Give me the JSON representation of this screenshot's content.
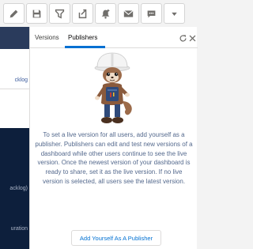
{
  "toolbar": {
    "buttons": [
      {
        "icon": "pencil-icon"
      },
      {
        "icon": "save-icon"
      },
      {
        "icon": "filter-funnel-icon"
      },
      {
        "icon": "share-icon"
      },
      {
        "icon": "notification-bell-icon"
      },
      {
        "icon": "email-icon"
      },
      {
        "icon": "chat-icon"
      },
      {
        "icon": "dropdown-arrow-icon"
      }
    ]
  },
  "left_strip": {
    "row1": "cklog",
    "row2": "acklog)",
    "row3": "uration"
  },
  "panel": {
    "tabs": [
      "Versions",
      "Publishers"
    ],
    "active_tab": "Publishers",
    "description": "To set a live version for all users, add yourself as a publisher. Publishers can edit and test new versions of a dashboard while other users continue to see the live version. Once the newest version of your dashboard is ready to share, set it as the live version. If no live version is selected, all users see the latest version.",
    "button_label": "Add Yourself As A Publisher"
  },
  "colors": {
    "accent": "#0070d2",
    "navy": "#0d1f3c",
    "body_text": "#54698d"
  }
}
